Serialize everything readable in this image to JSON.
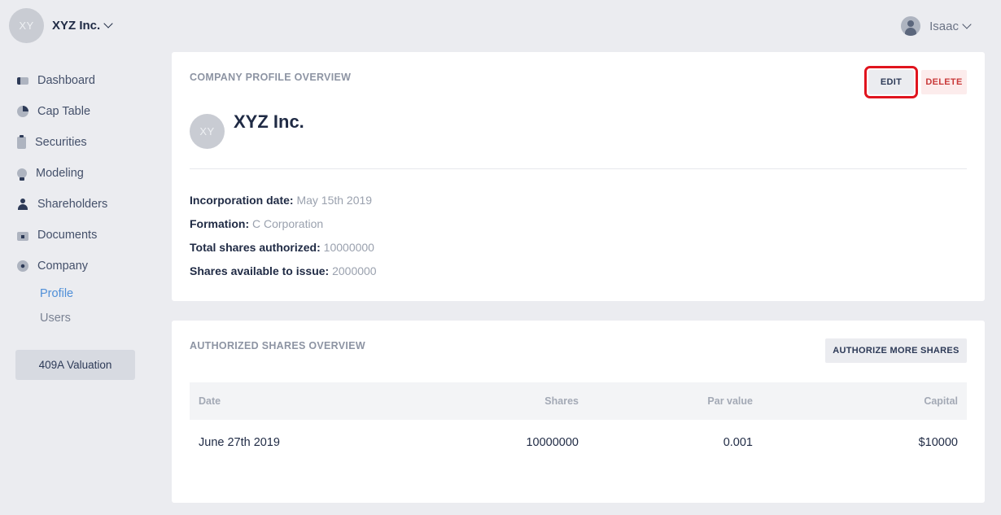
{
  "topbar": {
    "company_initials": "XY",
    "company_name": "XYZ Inc.",
    "user_name": "Isaac"
  },
  "sidebar": {
    "items": [
      {
        "label": "Dashboard",
        "icon": "dashboard-icon"
      },
      {
        "label": "Cap Table",
        "icon": "pie-chart-icon"
      },
      {
        "label": "Securities",
        "icon": "clipboard-icon"
      },
      {
        "label": "Modeling",
        "icon": "lightbulb-icon"
      },
      {
        "label": "Shareholders",
        "icon": "person-icon"
      },
      {
        "label": "Documents",
        "icon": "folder-icon"
      },
      {
        "label": "Company",
        "icon": "gear-icon"
      }
    ],
    "sub_items": [
      {
        "label": "Profile",
        "active": true
      },
      {
        "label": "Users",
        "active": false
      }
    ],
    "valuation_button": "409A Valuation"
  },
  "profile_card": {
    "title": "COMPANY PROFILE OVERVIEW",
    "edit_label": "EDIT",
    "delete_label": "DELETE",
    "avatar_initials": "XY",
    "company_name": "XYZ Inc.",
    "details": [
      {
        "key": "Incorporation date:",
        "value": "May 15th 2019"
      },
      {
        "key": "Formation:",
        "value": "C Corporation"
      },
      {
        "key": "Total shares authorized:",
        "value": "10000000"
      },
      {
        "key": "Shares available to issue:",
        "value": "2000000"
      }
    ]
  },
  "shares_card": {
    "title": "AUTHORIZED SHARES OVERVIEW",
    "authorize_label": "AUTHORIZE MORE SHARES",
    "columns": [
      "Date",
      "Shares",
      "Par value",
      "Capital"
    ],
    "rows": [
      [
        "June 27th 2019",
        "10000000",
        "0.001",
        "$10000"
      ]
    ]
  },
  "colors": {
    "background": "#ebecf0",
    "accent": "#4f8fd8",
    "danger": "#c93a3a",
    "highlight_box": "#e0141e"
  }
}
